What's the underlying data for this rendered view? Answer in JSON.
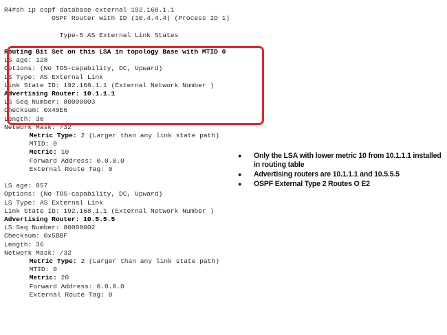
{
  "terminal": {
    "lines": [
      {
        "indent": 0,
        "text": "R4#sh ip ospf database external 192.168.1.1"
      },
      {
        "indent": 0,
        "text": "            OSPF Router with ID (10.4.4.4) (Process ID 1)"
      },
      {
        "indent": 0,
        "text": ""
      },
      {
        "indent": 0,
        "text": "              Type-5 AS External Link States"
      },
      {
        "indent": 0,
        "text": ""
      },
      {
        "indent": 0,
        "text": "Routing Bit Set on this LSA in topology Base with MTID 0",
        "bold": true
      },
      {
        "indent": 0,
        "text": "LS age: 128"
      },
      {
        "indent": 0,
        "text": "Options: (No TOS-capability, DC, Upward)"
      },
      {
        "indent": 0,
        "text": "LS Type: AS External Link"
      },
      {
        "indent": 0,
        "text": "Link State ID: 192.168.1.1 (External Network Number )"
      },
      {
        "indent": 0,
        "text": "Advertising Router: 10.1.1.1",
        "bold": true
      },
      {
        "indent": 0,
        "text": "LS Seq Number: 80000003"
      },
      {
        "indent": 0,
        "text": "Checksum: 0x49E6"
      },
      {
        "indent": 0,
        "text": "Length: 36"
      },
      {
        "indent": 0,
        "text": "Network Mask: /32"
      },
      {
        "indent": 6,
        "label": "Metric Type:",
        "text": " 2 (Larger than any link state path)"
      },
      {
        "indent": 6,
        "text": "MTID: 0"
      },
      {
        "indent": 6,
        "label": "Metric:",
        "text": " 10"
      },
      {
        "indent": 6,
        "text": "Forward Address: 0.0.0.0"
      },
      {
        "indent": 6,
        "text": "External Route Tag: 0"
      },
      {
        "indent": 0,
        "text": ""
      },
      {
        "indent": 0,
        "text": "LS age: 857"
      },
      {
        "indent": 0,
        "text": "Options: (No TOS-capability, DC, Upward)"
      },
      {
        "indent": 0,
        "text": "LS Type: AS External Link"
      },
      {
        "indent": 0,
        "text": "Link State ID: 192.168.1.1 (External Network Number )"
      },
      {
        "indent": 0,
        "text": "Advertising Router: 10.5.5.5",
        "bold": true
      },
      {
        "indent": 0,
        "text": "LS Seq Number: 80000002"
      },
      {
        "indent": 0,
        "text": "Checksum: 0x5BBF"
      },
      {
        "indent": 0,
        "text": "Length: 36"
      },
      {
        "indent": 0,
        "text": "Network Mask: /32"
      },
      {
        "indent": 6,
        "label": "Metric Type:",
        "text": " 2 (Larger than any link state path)"
      },
      {
        "indent": 6,
        "text": "MTID: 0"
      },
      {
        "indent": 6,
        "label": "Metric:",
        "text": " 20"
      },
      {
        "indent": 6,
        "text": "Forward Address: 0.0.0.0"
      },
      {
        "indent": 6,
        "text": "External Route Tag: 0"
      }
    ]
  },
  "highlight": {
    "color": "#e8242a"
  },
  "notes": {
    "bullet": "●",
    "items": [
      "Only the LSA with lower metric 10 from 10.1.1.1 installed in routing table",
      "Advertising routers are 10.1.1.1 and 10.5.5.5",
      "OSPF External Type 2 Routes O E2"
    ]
  }
}
